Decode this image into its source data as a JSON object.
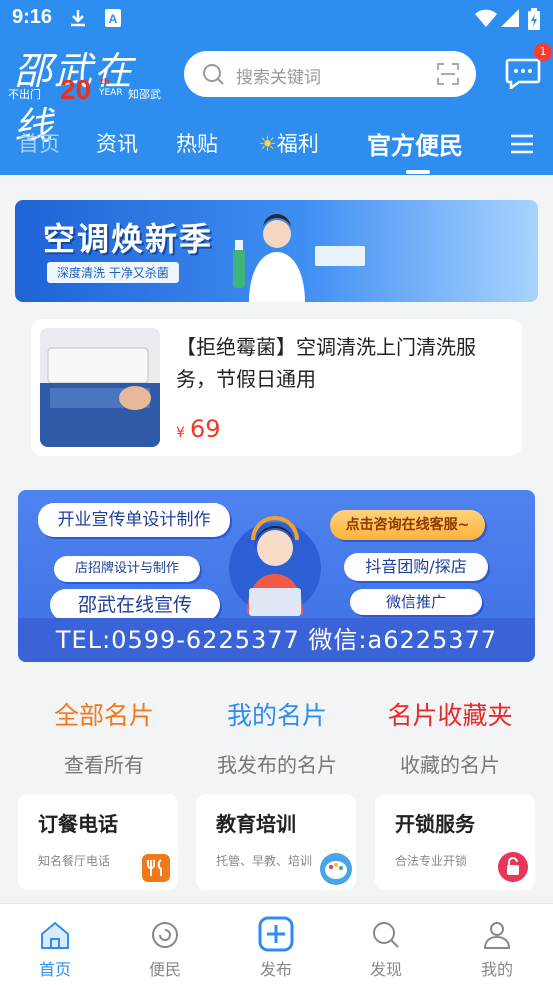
{
  "status_bar": {
    "time": "9:16"
  },
  "header": {
    "logo_text": "邵武在线",
    "logo_sub_left": "不出门",
    "logo_anniv": "20",
    "logo_th": "th",
    "logo_year": "YEAR",
    "logo_sub_right": "知邵武",
    "search_placeholder": "搜索关键词",
    "message_badge": "1"
  },
  "tabs": [
    {
      "label": "首页"
    },
    {
      "label": "资讯"
    },
    {
      "label": "热贴"
    },
    {
      "label": "福利"
    },
    {
      "label": "官方便民",
      "active": true
    }
  ],
  "banner1": {
    "title": "空调焕新季",
    "subtitle": "深度清洗 干净又杀菌"
  },
  "product": {
    "title": "【拒绝霉菌】空调清洗上门清洗服务，节假日通用",
    "currency": "¥",
    "price": "69"
  },
  "banner2": {
    "pill_1": "开业宣传单设计制作",
    "pill_2": "店招牌设计与制作",
    "pill_3": "邵武在线宣传",
    "pill_4": "点击咨询在线客服~",
    "pill_5": "抖音团购/探店",
    "pill_6": "微信推广",
    "contact": "TEL:0599-6225377 微信:a6225377"
  },
  "card_tabs": [
    {
      "label": "全部名片",
      "sub": "查看所有",
      "color": "#f07a1a"
    },
    {
      "label": "我的名片",
      "sub": "我发布的名片",
      "color": "#2e8ef0"
    },
    {
      "label": "名片收藏夹",
      "sub": "收藏的名片",
      "color": "#e62b2b"
    }
  ],
  "service_cards": [
    {
      "title": "订餐电话",
      "desc": "知名餐厅电话",
      "icon": "fork-knife-icon",
      "icon_color": "#f07a1a"
    },
    {
      "title": "教育培训",
      "desc": "托管、早教、培训",
      "icon": "palette-icon",
      "icon_color": "#49a3e8"
    },
    {
      "title": "开锁服务",
      "desc": "合法专业开锁",
      "icon": "lock-icon",
      "icon_color": "#e8365a"
    }
  ],
  "bottom_nav": [
    {
      "label": "首页",
      "active": true
    },
    {
      "label": "便民"
    },
    {
      "label": "发布"
    },
    {
      "label": "发现"
    },
    {
      "label": "我的"
    }
  ]
}
